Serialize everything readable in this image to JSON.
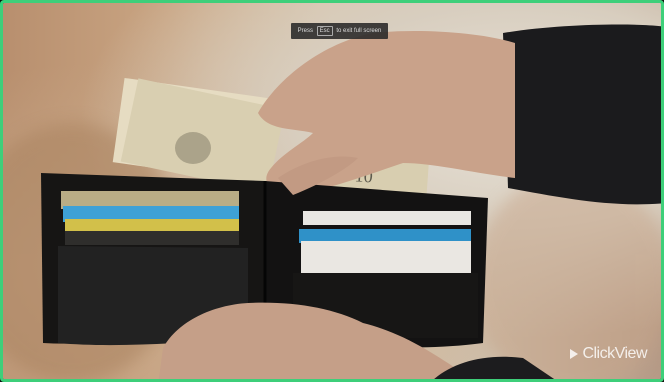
{
  "fullscreen_notice": {
    "prefix": "Press",
    "key": "Esc",
    "suffix": "to exit full screen"
  },
  "watermark": {
    "brand_text": "ClickView"
  },
  "colors": {
    "frame_border": "#3ecf7a"
  }
}
